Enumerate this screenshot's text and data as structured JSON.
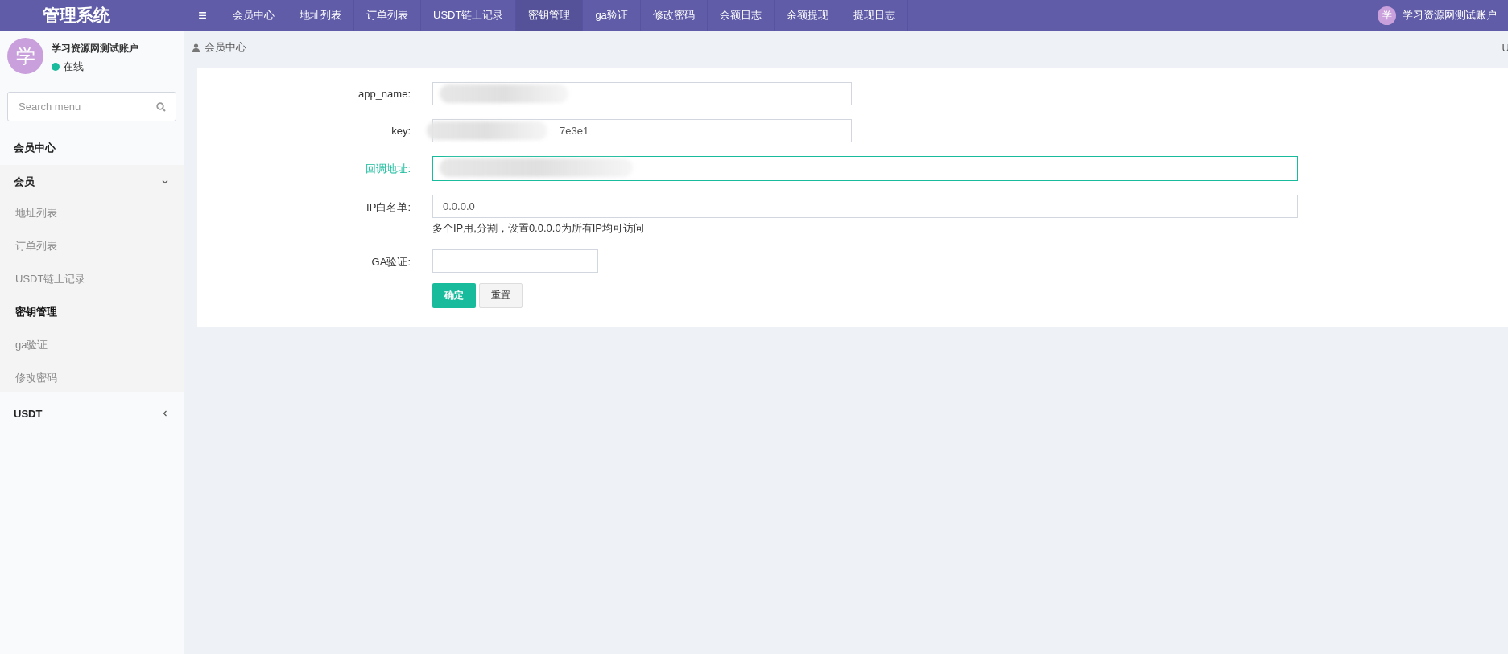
{
  "header": {
    "logo": "管理系统",
    "menu_icon": "≡",
    "nav": [
      {
        "label": "会员中心",
        "selected": false
      },
      {
        "label": "地址列表",
        "selected": false
      },
      {
        "label": "订单列表",
        "selected": false
      },
      {
        "label": "USDT链上记录",
        "selected": false
      },
      {
        "label": "密钥管理",
        "selected": true
      },
      {
        "label": "ga验证",
        "selected": false
      },
      {
        "label": "修改密码",
        "selected": false
      },
      {
        "label": "余额日志",
        "selected": false
      },
      {
        "label": "余额提现",
        "selected": false
      },
      {
        "label": "提现日志",
        "selected": false
      }
    ],
    "user": {
      "avatar": "学",
      "name": "学习资源网测试账户"
    }
  },
  "sidebar": {
    "user": {
      "avatar": "学",
      "name": "学习资源网测试账户",
      "status": "在线"
    },
    "search": {
      "placeholder": "Search menu"
    },
    "items": [
      {
        "label": "会员中心"
      },
      {
        "label": "会员",
        "expanded": true,
        "children": [
          {
            "label": "地址列表",
            "selected": false
          },
          {
            "label": "订单列表",
            "selected": false
          },
          {
            "label": "USDT链上记录",
            "selected": false
          },
          {
            "label": "密钥管理",
            "selected": true
          },
          {
            "label": "ga验证",
            "selected": false
          },
          {
            "label": "修改密码",
            "selected": false
          }
        ]
      },
      {
        "label": "USDT",
        "expanded": false
      }
    ]
  },
  "breadcrumb": {
    "label": "会员中心",
    "right_text": "U"
  },
  "form": {
    "fields": [
      {
        "label": "app_name:",
        "focused": false,
        "blurred": true
      },
      {
        "label": "key:",
        "value": "7e3e1",
        "focused": false,
        "blurred": true
      },
      {
        "label": "回调地址:",
        "focused": true,
        "blurred": true
      },
      {
        "label": "IP白名单:",
        "value": "0.0.0.0",
        "focused": false,
        "help": "多个IP用,分割，设置0.0.0.0为所有IP均可访问"
      },
      {
        "label": "GA验证:",
        "focused": false
      }
    ],
    "buttons": [
      {
        "label": "确定",
        "kind": "primary"
      },
      {
        "label": "重置",
        "kind": "default"
      }
    ]
  }
}
